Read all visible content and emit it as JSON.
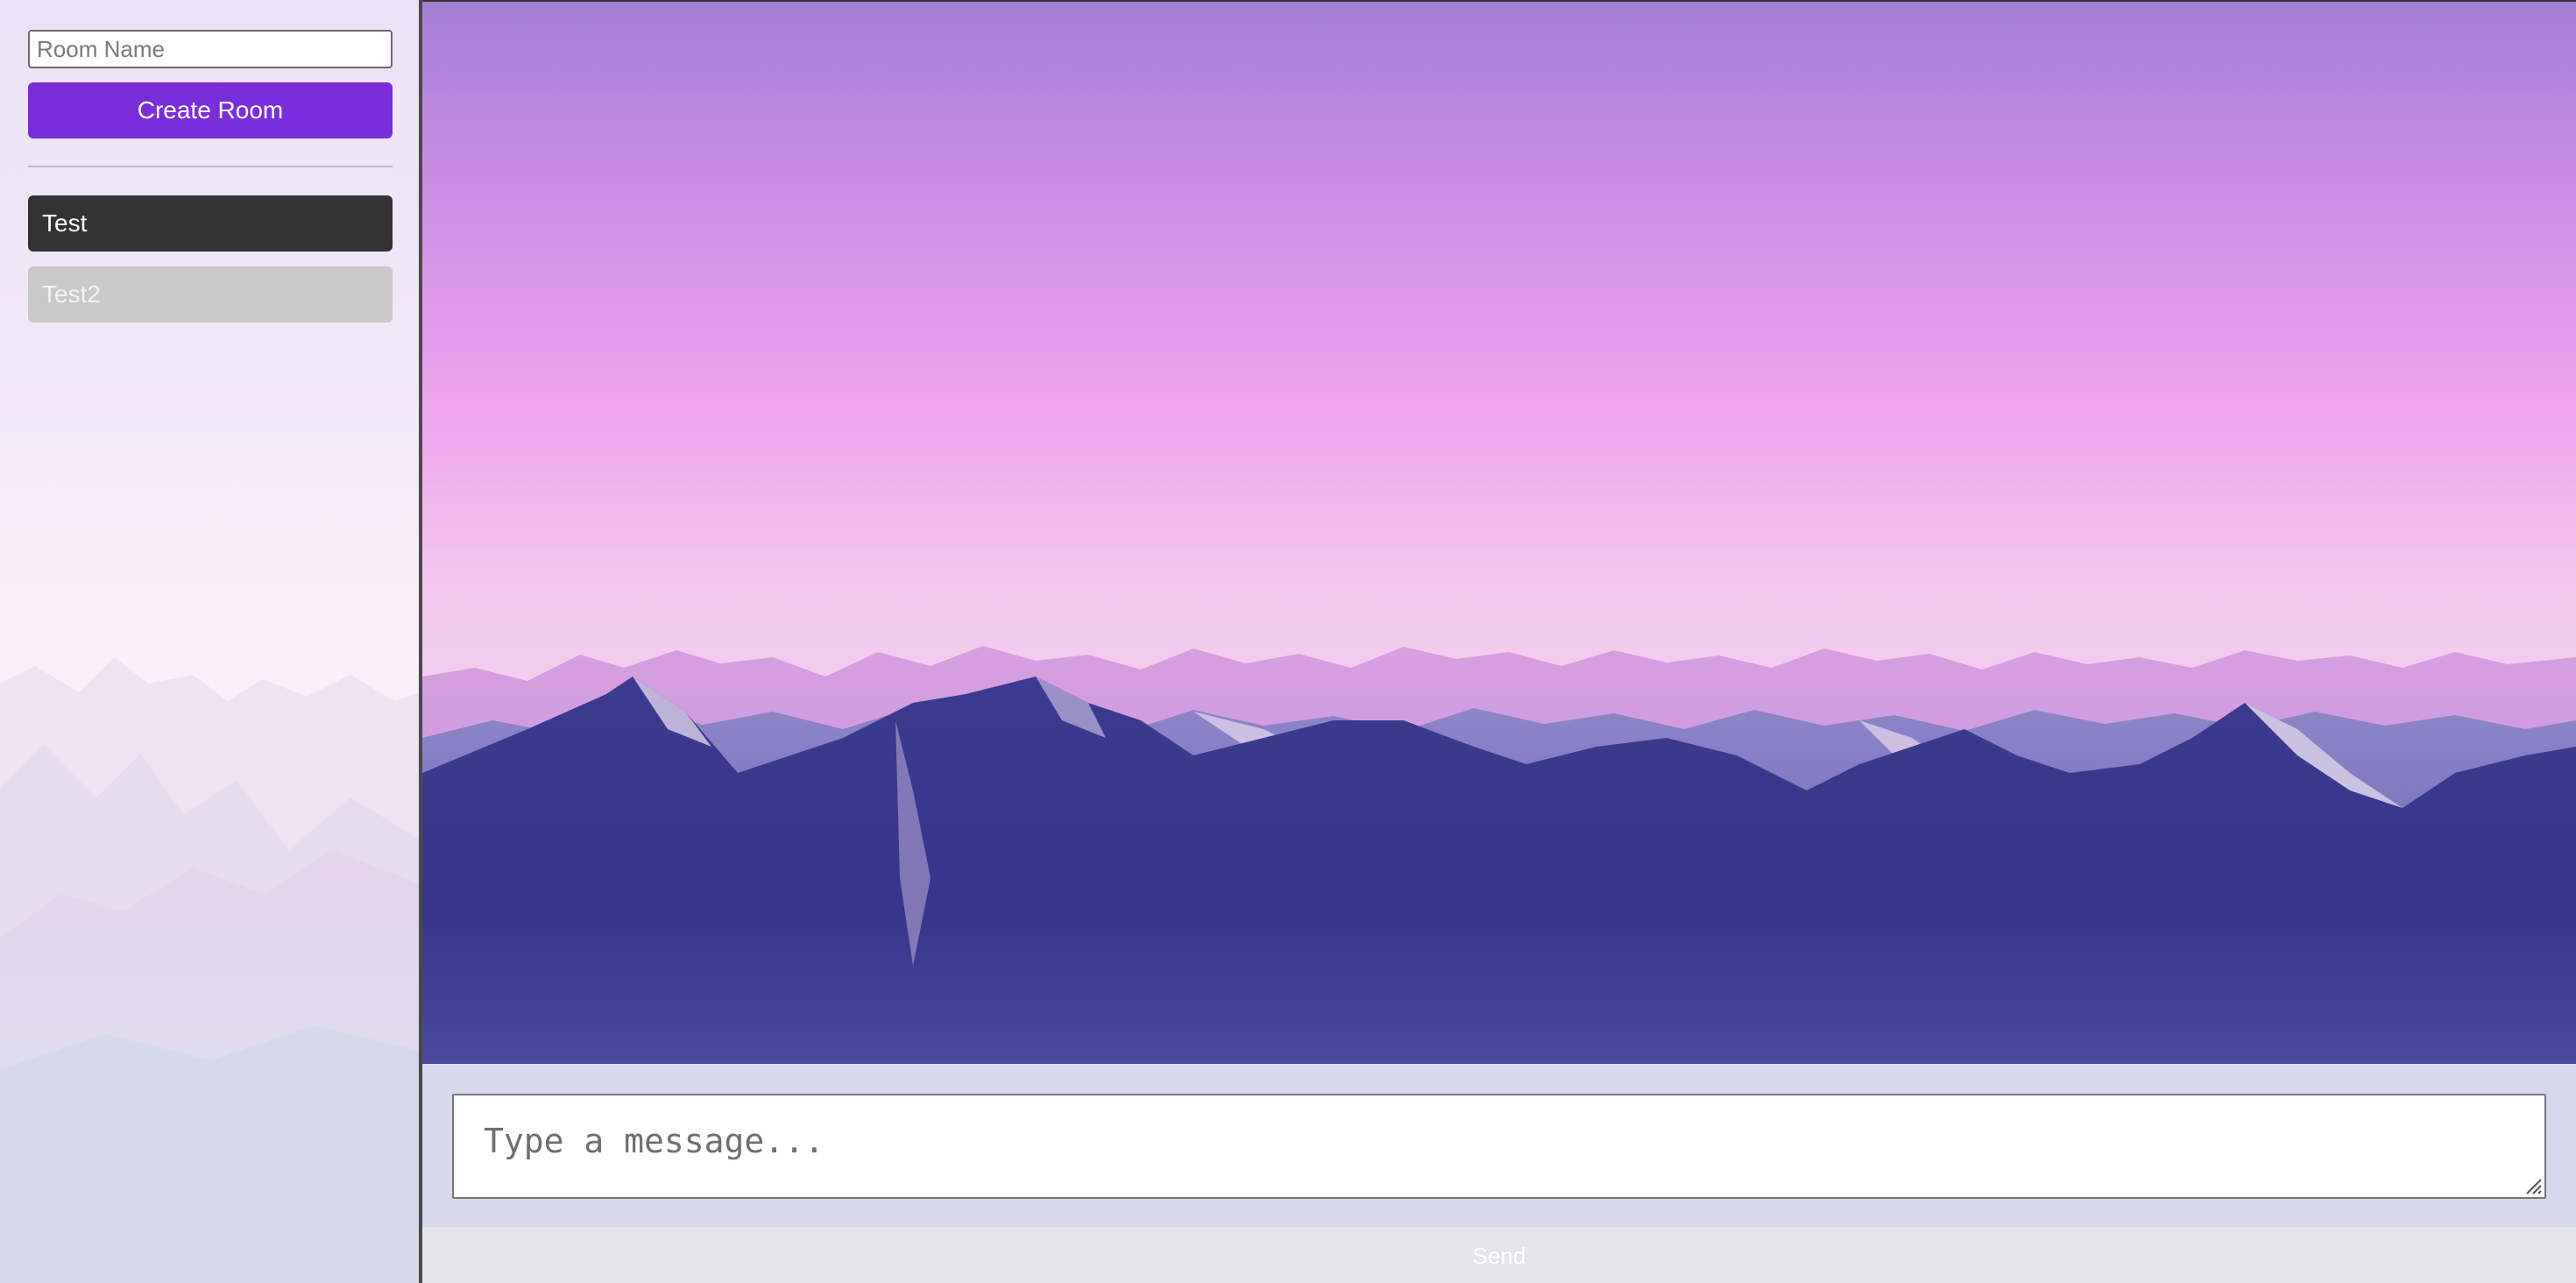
{
  "sidebar": {
    "room_name_placeholder": "Room Name",
    "create_room_label": "Create Room",
    "rooms": [
      {
        "label": "Test",
        "selected": true
      },
      {
        "label": "Test2",
        "selected": false
      }
    ]
  },
  "composer": {
    "message_placeholder": "Type a message...",
    "send_label": "Send"
  },
  "colors": {
    "accent": "#7b2ddb",
    "active_room": "#333333",
    "inactive_room": "#c9c9c9"
  }
}
